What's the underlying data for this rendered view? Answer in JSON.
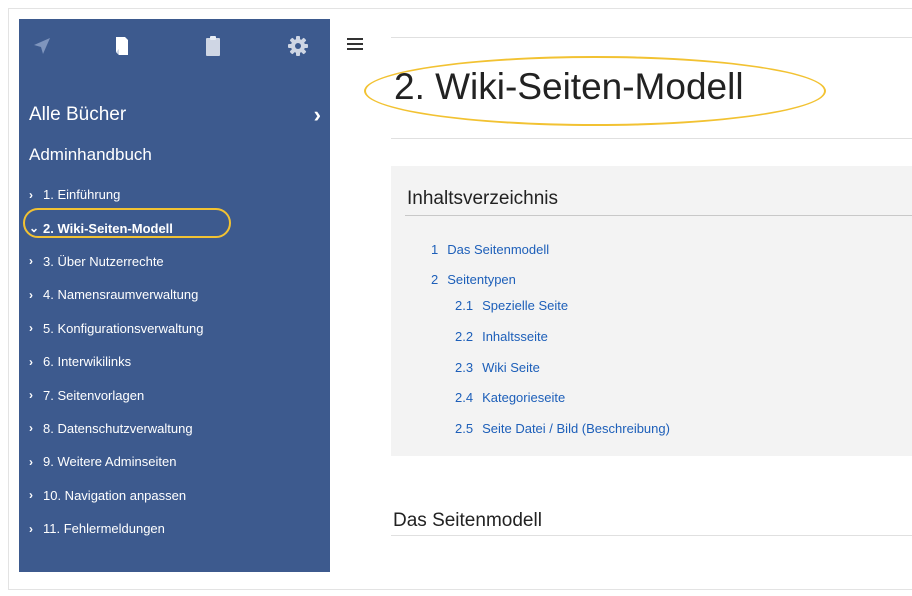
{
  "sidebar": {
    "tools": [
      "navigation-icon",
      "book-icon",
      "clipboard-icon",
      "gear-icon"
    ],
    "all_books_label": "Alle Bücher",
    "all_books_chevron": "›",
    "book_title": "Adminhandbuch",
    "items": [
      {
        "label": "1. Einführung",
        "active": false
      },
      {
        "label": "2. Wiki-Seiten-Modell",
        "active": true
      },
      {
        "label": "3. Über Nutzerrechte",
        "active": false
      },
      {
        "label": "4. Namensraumverwaltung",
        "active": false
      },
      {
        "label": "5. Konfigurationsverwaltung",
        "active": false
      },
      {
        "label": "6. Interwikilinks",
        "active": false
      },
      {
        "label": "7. Seitenvorlagen",
        "active": false
      },
      {
        "label": "8. Datenschutzverwaltung",
        "active": false
      },
      {
        "label": "9. Weitere Adminseiten",
        "active": false
      },
      {
        "label": "10. Navigation anpassen",
        "active": false
      },
      {
        "label": "11. Fehlermeldungen",
        "active": false
      }
    ]
  },
  "page": {
    "title": "2. Wiki-Seiten-Modell",
    "highlight_color": "#f2c232",
    "sidebar_color": "#3d5a8e",
    "link_color": "#1d5fb9"
  },
  "toc": {
    "heading": "Inhaltsverzeichnis",
    "items": [
      {
        "num": "1",
        "label": "Das Seitenmodell",
        "level": 1
      },
      {
        "num": "2",
        "label": "Seitentypen",
        "level": 1
      },
      {
        "num": "2.1",
        "label": "Spezielle Seite",
        "level": 2
      },
      {
        "num": "2.2",
        "label": "Inhaltsseite",
        "level": 2
      },
      {
        "num": "2.3",
        "label": "Wiki Seite",
        "level": 2
      },
      {
        "num": "2.4",
        "label": "Kategorieseite",
        "level": 2
      },
      {
        "num": "2.5",
        "label": "Seite Datei / Bild (Beschreibung)",
        "level": 2
      }
    ]
  },
  "section": {
    "heading": "Das Seitenmodell"
  }
}
